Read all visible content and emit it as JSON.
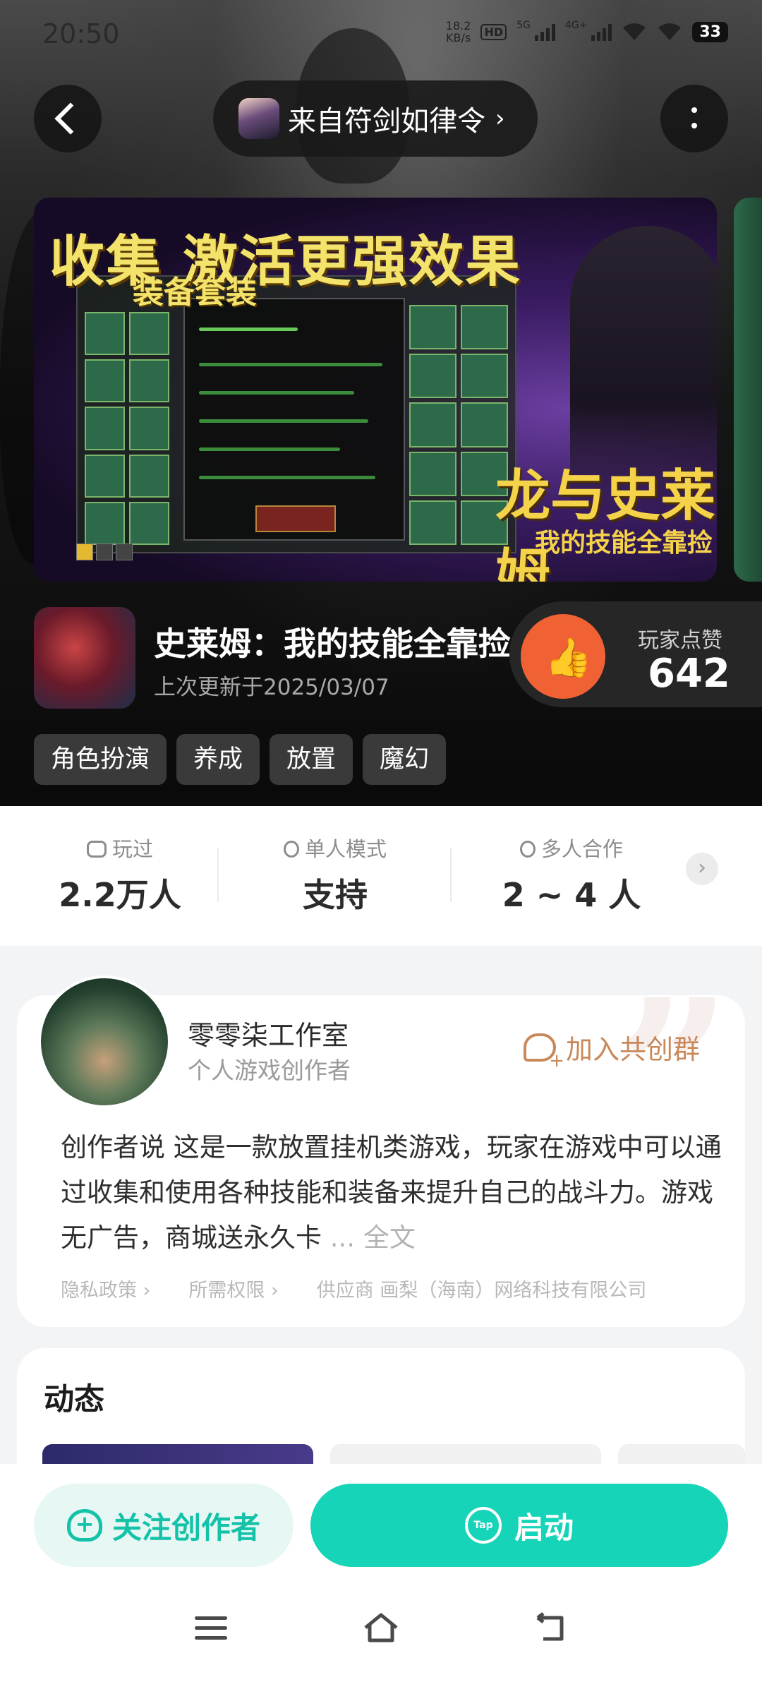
{
  "status_bar": {
    "time": "20:50",
    "net_speed_top": "18.2",
    "net_speed_unit": "KB/s",
    "hd_badge": "HD",
    "sim1": "5G",
    "sim2": "4G+",
    "battery": "33"
  },
  "header": {
    "source_label": "来自符剑如律令",
    "source_arrow": "›"
  },
  "banner": {
    "headline": "收集 激活更强效果",
    "subline": "装备套装",
    "logo": "龙与史莱姆",
    "logo_sub": "我的技能全靠捡"
  },
  "game": {
    "title": "史莱姆：我的技能全靠捡",
    "updated": "上次更新于2025/03/07",
    "like_label": "玩家点赞",
    "like_count": "642",
    "tags": [
      "角色扮演",
      "养成",
      "放置",
      "魔幻"
    ]
  },
  "stats": [
    {
      "label": "玩过",
      "value": "2.2万人"
    },
    {
      "label": "单人模式",
      "value": "支持"
    },
    {
      "label": "多人合作",
      "value": "2 ~ 4 人"
    }
  ],
  "creator": {
    "name": "零零柒工作室",
    "role": "个人游戏创作者",
    "join_label": "加入共创群",
    "desc_lead": "创作者说",
    "desc": "这是一款放置挂机类游戏，玩家在游戏中可以通过收集和使用各种技能和装备来提升自己的战斗力。游戏无广告，商城送永久卡",
    "ellipsis": "...",
    "full_text": "全文",
    "links": [
      "隐私政策 ›",
      "所需权限 ›",
      "供应商 画梨（海南）网络科技有限公司"
    ]
  },
  "feed": {
    "title": "动态"
  },
  "actions": {
    "follow_label": "关注创作者",
    "launch_label": "启动",
    "tap_logo": "Tap"
  },
  "colors": {
    "accent": "#16d4b8",
    "like": "#f06234",
    "join": "#c9885a"
  }
}
